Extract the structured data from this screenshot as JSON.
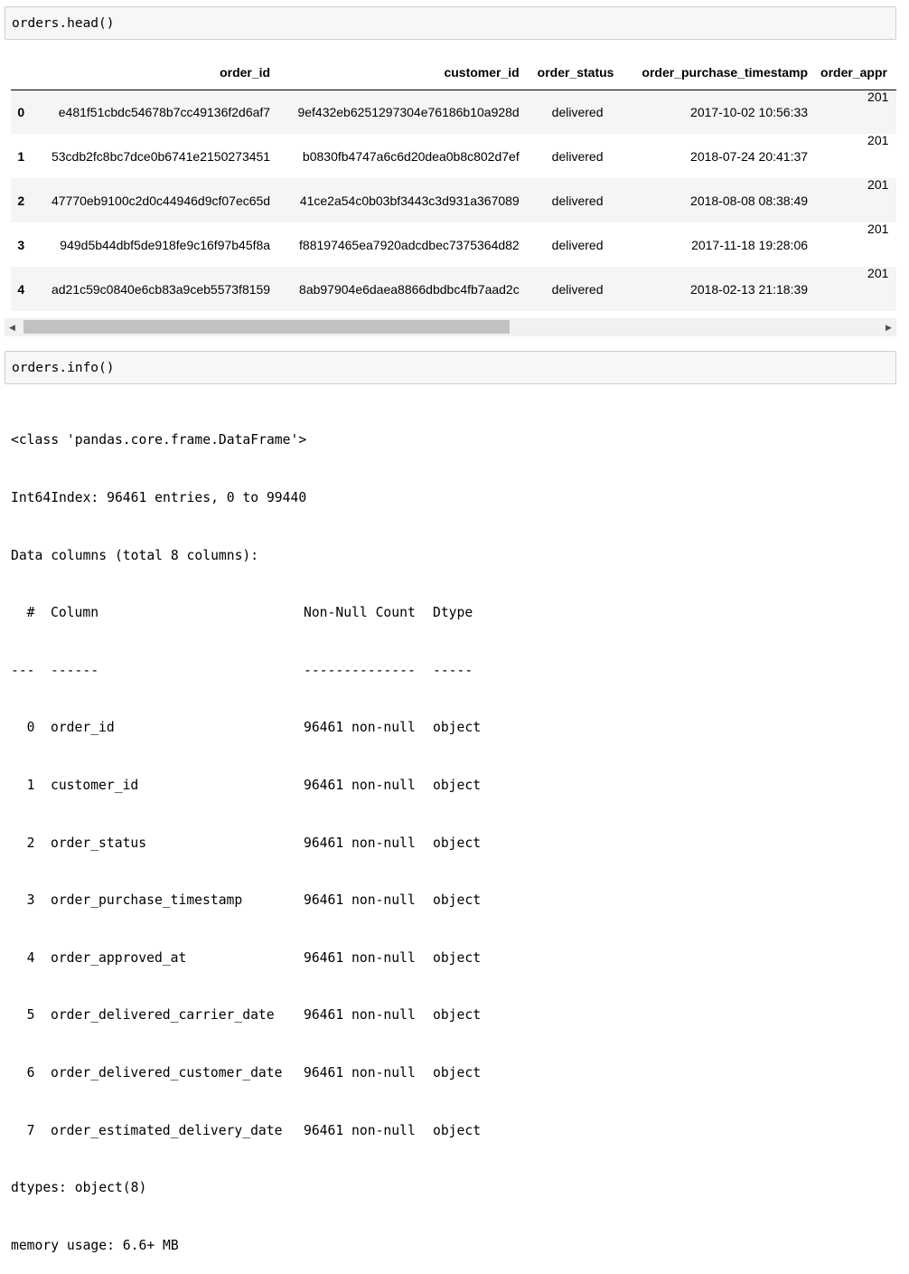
{
  "cells": {
    "head_code": "orders.head()",
    "info_code": "orders.info()"
  },
  "dataframe": {
    "columns": [
      "order_id",
      "customer_id",
      "order_status",
      "order_purchase_timestamp",
      "order_appr"
    ],
    "rows": [
      {
        "index": "0",
        "order_id": "e481f51cbdc54678b7cc49136f2d6af7",
        "customer_id": "9ef432eb6251297304e76186b10a928d",
        "order_status": "delivered",
        "order_purchase_timestamp": "2017-10-02 10:56:33",
        "order_approved_at": "201"
      },
      {
        "index": "1",
        "order_id": "53cdb2fc8bc7dce0b6741e2150273451",
        "customer_id": "b0830fb4747a6c6d20dea0b8c802d7ef",
        "order_status": "delivered",
        "order_purchase_timestamp": "2018-07-24 20:41:37",
        "order_approved_at": "201"
      },
      {
        "index": "2",
        "order_id": "47770eb9100c2d0c44946d9cf07ec65d",
        "customer_id": "41ce2a54c0b03bf3443c3d931a367089",
        "order_status": "delivered",
        "order_purchase_timestamp": "2018-08-08 08:38:49",
        "order_approved_at": "201"
      },
      {
        "index": "3",
        "order_id": "949d5b44dbf5de918fe9c16f97b45f8a",
        "customer_id": "f88197465ea7920adcdbec7375364d82",
        "order_status": "delivered",
        "order_purchase_timestamp": "2017-11-18 19:28:06",
        "order_approved_at": "201"
      },
      {
        "index": "4",
        "order_id": "ad21c59c0840e6cb83a9ceb5573f8159",
        "customer_id": "8ab97904e6daea8866dbdbc4fb7aad2c",
        "order_status": "delivered",
        "order_purchase_timestamp": "2018-02-13 21:18:39",
        "order_approved_at": "201"
      }
    ]
  },
  "scrollbar": {
    "left_icon": "triangle-left-icon",
    "right_icon": "triangle-right-icon",
    "left_glyph": "◀",
    "right_glyph": "▶"
  },
  "info_output": {
    "class_line": "<class 'pandas.core.frame.DataFrame'>",
    "index_line": "Int64Index: 96461 entries, 0 to 99440",
    "columns_line": "Data columns (total 8 columns):",
    "header": {
      "idx": "#",
      "column": "Column",
      "count": "Non-Null Count",
      "dtype": "Dtype"
    },
    "separator": {
      "idx": "---",
      "column": "------",
      "count": "--------------",
      "dtype": "-----"
    },
    "rows": [
      {
        "idx": "0",
        "column": "order_id",
        "count": "96461 non-null",
        "dtype": "object"
      },
      {
        "idx": "1",
        "column": "customer_id",
        "count": "96461 non-null",
        "dtype": "object"
      },
      {
        "idx": "2",
        "column": "order_status",
        "count": "96461 non-null",
        "dtype": "object"
      },
      {
        "idx": "3",
        "column": "order_purchase_timestamp",
        "count": "96461 non-null",
        "dtype": "object"
      },
      {
        "idx": "4",
        "column": "order_approved_at",
        "count": "96461 non-null",
        "dtype": "object"
      },
      {
        "idx": "5",
        "column": "order_delivered_carrier_date",
        "count": "96461 non-null",
        "dtype": "object"
      },
      {
        "idx": "6",
        "column": "order_delivered_customer_date",
        "count": "96461 non-null",
        "dtype": "object"
      },
      {
        "idx": "7",
        "column": "order_estimated_delivery_date",
        "count": "96461 non-null",
        "dtype": "object"
      }
    ],
    "dtypes_line": "dtypes: object(8)",
    "memory_line": "memory usage: 6.6+ MB"
  }
}
